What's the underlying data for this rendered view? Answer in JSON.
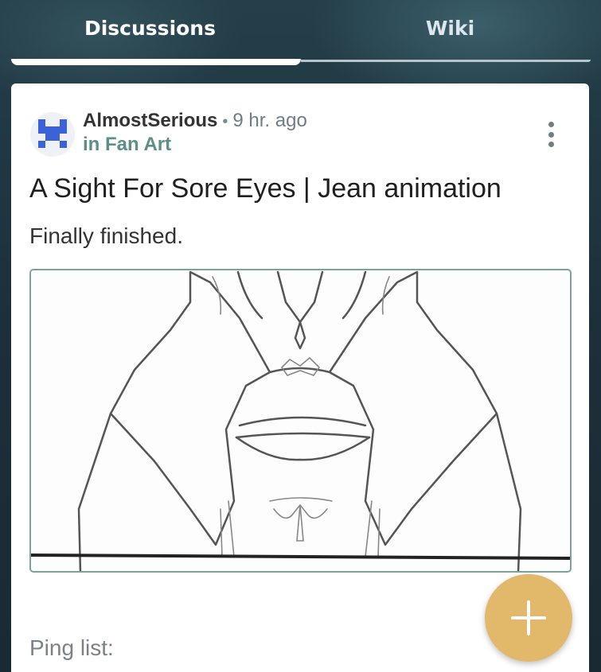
{
  "tabs": {
    "discussions_label": "Discussions",
    "wiki_label": "Wiki"
  },
  "post": {
    "author": "AlmostSerious",
    "separator": "•",
    "time": "9 hr. ago",
    "category": "in Fan Art",
    "title": "A Sight For Sore Eyes | Jean animation",
    "body": "Finally finished.",
    "ping_label": "Ping list:"
  },
  "icons": {
    "more": "more-vertical-icon",
    "fab": "plus-icon",
    "avatar": "pixel-heart-avatar-icon"
  },
  "colors": {
    "category": "#5c8f87",
    "fab": "#e2b86a",
    "avatar_accent": "#3b62d9",
    "image_border": "#7ba39c"
  }
}
